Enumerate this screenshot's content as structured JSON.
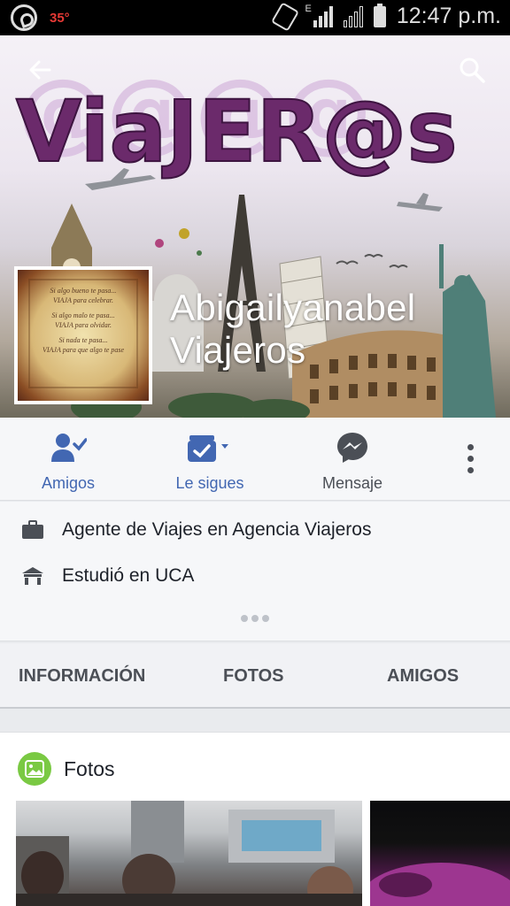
{
  "status_bar": {
    "temperature": "35°",
    "network": "E",
    "time": "12:47 p.m."
  },
  "cover": {
    "logo_text": "ViaJER@s"
  },
  "profile": {
    "name_line1": "Abigailyanabel",
    "name_line2": "Viajeros",
    "avatar_lines": [
      "Si algo bueno te pasa...",
      "VIAJA para celebrar.",
      "Si algo malo te pasa...",
      "VIAJA para olvidar.",
      "Si nada te pasa...",
      "VIAJA para que algo te pase"
    ]
  },
  "actions": {
    "friends_label": "Amigos",
    "following_label": "Le sigues",
    "message_label": "Mensaje"
  },
  "info": {
    "work": "Agente de Viajes en Agencia Viajeros",
    "education": "Estudió en UCA"
  },
  "tabs": {
    "info": "INFORMACIÓN",
    "photos": "FOTOS",
    "friends": "AMIGOS"
  },
  "photos_section": {
    "title": "Fotos"
  },
  "colors": {
    "accent": "#4267b2",
    "logo_purple": "#6b2a6b",
    "photos_icon_green": "#7ac943"
  }
}
